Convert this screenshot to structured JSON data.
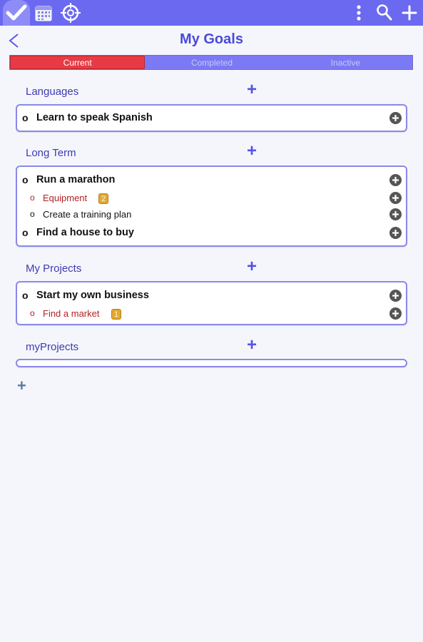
{
  "toolbar": {
    "tabs": [
      "goals-check-icon",
      "calendar-icon",
      "target-icon"
    ],
    "actions": [
      "overflow-menu-icon",
      "search-icon",
      "add-icon"
    ]
  },
  "header": {
    "title": "My Goals",
    "back_icon": "chevron-left-icon"
  },
  "segments": {
    "selected": "Current",
    "items": [
      "Current",
      "Completed",
      "Inactive"
    ]
  },
  "sections": [
    {
      "title": "Languages",
      "add": "+",
      "rows": [
        {
          "bullet": "o",
          "label": "Learn to speak Spanish",
          "level": "goal"
        }
      ]
    },
    {
      "title": "Long Term",
      "add": "+",
      "rows": [
        {
          "bullet": "o",
          "label": "Run a marathon",
          "level": "goal"
        },
        {
          "bullet": "o",
          "label": "Equipment",
          "level": "sub",
          "badge": "2",
          "color": "#b22224"
        },
        {
          "bullet": "o",
          "label": "Create a training plan",
          "level": "sub"
        },
        {
          "bullet": "o",
          "label": "Find a house to buy",
          "level": "goal"
        }
      ]
    },
    {
      "title": "My Projects",
      "add": "+",
      "rows": [
        {
          "bullet": "o",
          "label": "Start my own business",
          "level": "goal"
        },
        {
          "bullet": "o",
          "label": "Find a market",
          "level": "sub",
          "badge": "1",
          "color": "#b22224"
        }
      ]
    },
    {
      "title": "myProjects",
      "add": "+",
      "rows": []
    }
  ],
  "bottom_add": "+",
  "colors": {
    "accent": "#6b69f0",
    "title": "#4b4ad8",
    "selected_segment": "#e83a45",
    "subgoal_red": "#b22224",
    "badge": "#e2a830"
  }
}
